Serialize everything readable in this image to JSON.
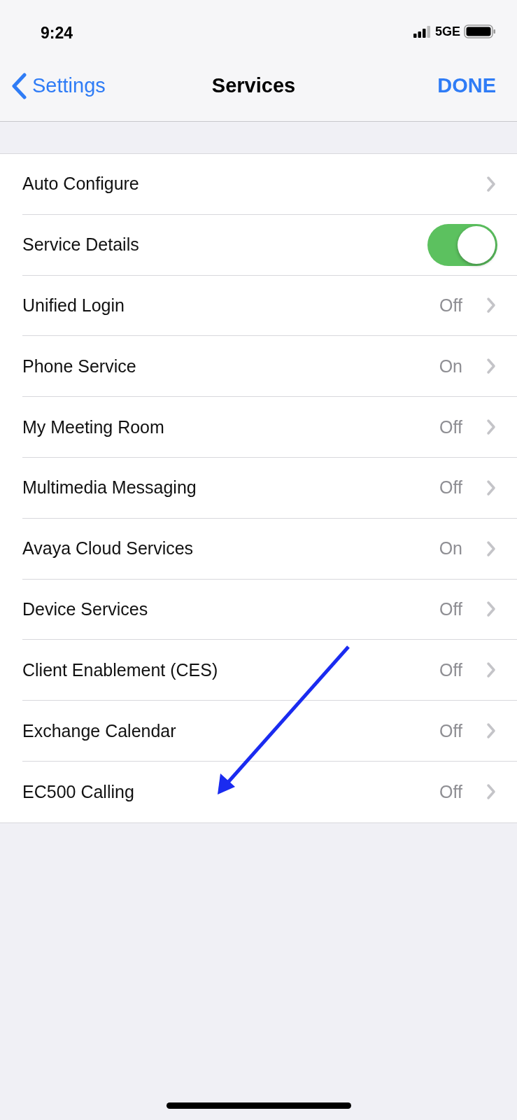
{
  "status_bar": {
    "time": "9:24",
    "network": "5GE"
  },
  "nav": {
    "back": "Settings",
    "title": "Services",
    "action": "DONE"
  },
  "rows": [
    {
      "kind": "link",
      "label": "Auto Configure"
    },
    {
      "kind": "toggle",
      "label": "Service Details",
      "on": true
    },
    {
      "kind": "link",
      "label": "Unified Login",
      "value": "Off"
    },
    {
      "kind": "link",
      "label": "Phone Service",
      "value": "On"
    },
    {
      "kind": "link",
      "label": "My Meeting Room",
      "value": "Off"
    },
    {
      "kind": "link",
      "label": "Multimedia Messaging",
      "value": "Off"
    },
    {
      "kind": "link",
      "label": "Avaya Cloud Services",
      "value": "On"
    },
    {
      "kind": "link",
      "label": "Device Services",
      "value": "Off"
    },
    {
      "kind": "link",
      "label": "Client Enablement (CES)",
      "value": "Off"
    },
    {
      "kind": "link",
      "label": "Exchange Calendar",
      "value": "Off"
    },
    {
      "kind": "link",
      "label": "EC500 Calling",
      "value": "Off"
    }
  ]
}
